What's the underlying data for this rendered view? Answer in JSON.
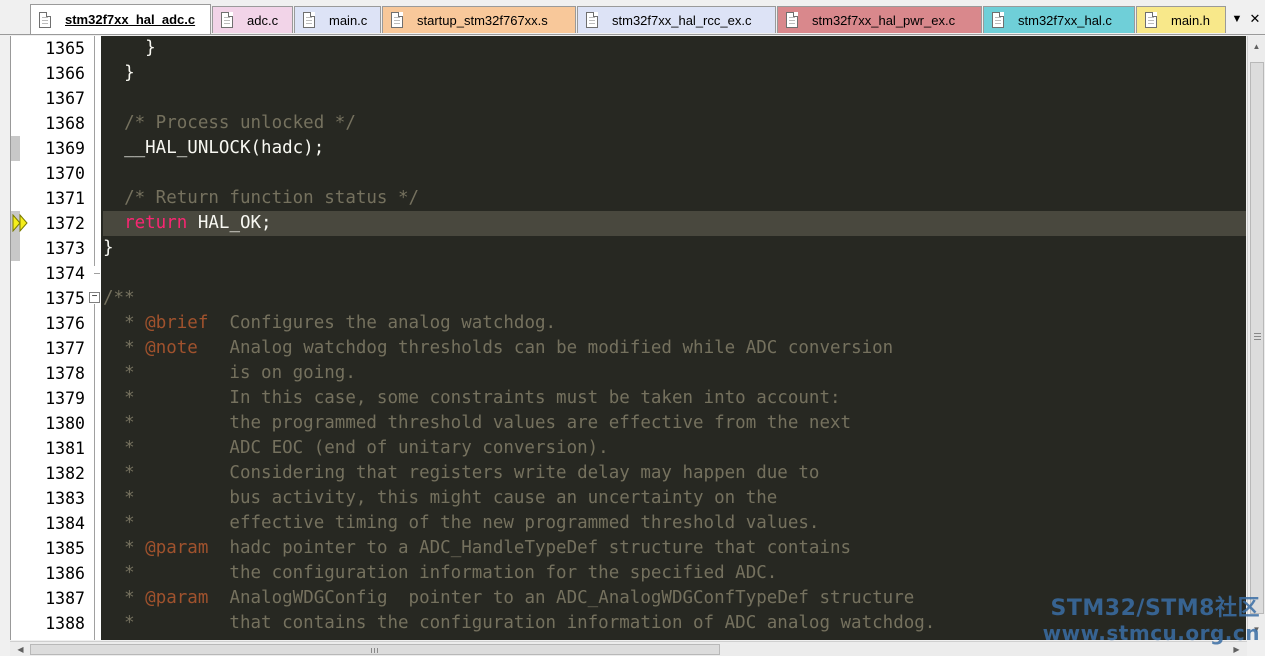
{
  "tabs": [
    {
      "label": "stm32f7xx_hal_adc.c",
      "active": true,
      "color": "#ffffff"
    },
    {
      "label": "adc.c",
      "active": false,
      "color": "#f2d4e8"
    },
    {
      "label": "main.c",
      "active": false,
      "color": "#dde3f6"
    },
    {
      "label": "startup_stm32f767xx.s",
      "active": false,
      "color": "#f8c89a"
    },
    {
      "label": "stm32f7xx_hal_rcc_ex.c",
      "active": false,
      "color": "#dde3f6"
    },
    {
      "label": "stm32f7xx_hal_pwr_ex.c",
      "active": false,
      "color": "#d9888c"
    },
    {
      "label": "stm32f7xx_hal.c",
      "active": false,
      "color": "#6fcfd8"
    },
    {
      "label": "main.h",
      "active": false,
      "color": "#f8e88a"
    }
  ],
  "tab_menu_icon": "▼",
  "tab_close_icon": "✕",
  "editor": {
    "current_line": 1372,
    "lines": [
      {
        "num": "1365",
        "segments": [
          {
            "t": "    }",
            "c": "plain"
          }
        ]
      },
      {
        "num": "1366",
        "segments": [
          {
            "t": "  }",
            "c": "plain"
          }
        ]
      },
      {
        "num": "1367",
        "segments": []
      },
      {
        "num": "1368",
        "segments": [
          {
            "t": "  /* Process unlocked */",
            "c": "comment"
          }
        ]
      },
      {
        "num": "1369",
        "segments": [
          {
            "t": "  __HAL_UNLOCK(hadc);",
            "c": "plain"
          }
        ]
      },
      {
        "num": "1370",
        "segments": []
      },
      {
        "num": "1371",
        "segments": [
          {
            "t": "  /* Return function status */",
            "c": "comment"
          }
        ]
      },
      {
        "num": "1372",
        "segments": [
          {
            "t": "  ",
            "c": "plain"
          },
          {
            "t": "return",
            "c": "keyword"
          },
          {
            "t": " HAL_OK;",
            "c": "plain"
          }
        ]
      },
      {
        "num": "1373",
        "segments": [
          {
            "t": "}",
            "c": "plain"
          }
        ]
      },
      {
        "num": "1374",
        "segments": []
      },
      {
        "num": "1375",
        "segments": [
          {
            "t": "/**",
            "c": "comment"
          }
        ]
      },
      {
        "num": "1376",
        "segments": [
          {
            "t": "  * ",
            "c": "comment"
          },
          {
            "t": "@brief",
            "c": "tag"
          },
          {
            "t": "  Configures the analog watchdog.",
            "c": "comment"
          }
        ]
      },
      {
        "num": "1377",
        "segments": [
          {
            "t": "  * ",
            "c": "comment"
          },
          {
            "t": "@note",
            "c": "tag"
          },
          {
            "t": "   Analog watchdog thresholds can be modified while ADC conversion",
            "c": "comment"
          }
        ]
      },
      {
        "num": "1378",
        "segments": [
          {
            "t": "  *         is on going.",
            "c": "comment"
          }
        ]
      },
      {
        "num": "1379",
        "segments": [
          {
            "t": "  *         In this case, some constraints must be taken into account:",
            "c": "comment"
          }
        ]
      },
      {
        "num": "1380",
        "segments": [
          {
            "t": "  *         the programmed threshold values are effective from the next",
            "c": "comment"
          }
        ]
      },
      {
        "num": "1381",
        "segments": [
          {
            "t": "  *         ADC EOC (end of unitary conversion).",
            "c": "comment"
          }
        ]
      },
      {
        "num": "1382",
        "segments": [
          {
            "t": "  *         Considering that registers write delay may happen due to",
            "c": "comment"
          }
        ]
      },
      {
        "num": "1383",
        "segments": [
          {
            "t": "  *         bus activity, this might cause an uncertainty on the",
            "c": "comment"
          }
        ]
      },
      {
        "num": "1384",
        "segments": [
          {
            "t": "  *         effective timing of the new programmed threshold values.",
            "c": "comment"
          }
        ]
      },
      {
        "num": "1385",
        "segments": [
          {
            "t": "  * ",
            "c": "comment"
          },
          {
            "t": "@param",
            "c": "tag"
          },
          {
            "t": "  hadc pointer to a ADC_HandleTypeDef structure that contains",
            "c": "comment"
          }
        ]
      },
      {
        "num": "1386",
        "segments": [
          {
            "t": "  *         the configuration information for the specified ADC.",
            "c": "comment"
          }
        ]
      },
      {
        "num": "1387",
        "segments": [
          {
            "t": "  * ",
            "c": "comment"
          },
          {
            "t": "@param",
            "c": "tag"
          },
          {
            "t": "  AnalogWDGConfig  pointer to an ADC_AnalogWDGConfTypeDef structure",
            "c": "comment"
          }
        ]
      },
      {
        "num": "1388",
        "segments": [
          {
            "t": "  *         that contains the configuration information of ADC analog watchdog.",
            "c": "comment"
          }
        ]
      }
    ]
  },
  "watermark": {
    "line1": "STM32/STM8社区",
    "line2": "www.stmcu.org.cn"
  }
}
